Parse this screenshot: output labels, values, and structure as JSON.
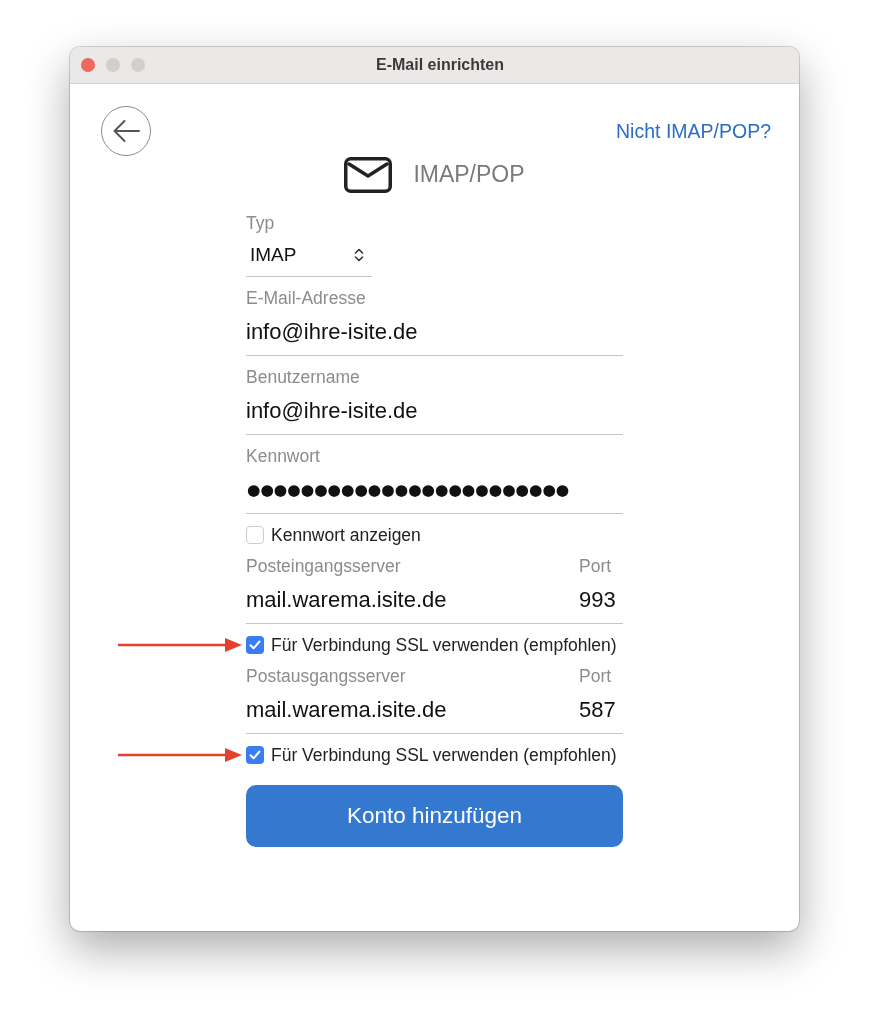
{
  "window": {
    "title": "E-Mail einrichten"
  },
  "header": {
    "link": "Nicht IMAP/POP?"
  },
  "account_type": {
    "name": "IMAP/POP"
  },
  "form": {
    "rows": [
      {
        "kind": "select",
        "label": "Typ",
        "value": "IMAP"
      },
      {
        "kind": "text",
        "label": "E-Mail-Adresse",
        "value": "info@ihre-isite.de"
      },
      {
        "kind": "text",
        "label": "Benutzername",
        "value": "info@ihre-isite.de"
      },
      {
        "kind": "password",
        "label": "Kennwort",
        "value": "●●●●●●●●●●●●●●●●●●●●●●●●"
      },
      {
        "kind": "checkbox",
        "label": "Kennwort anzeigen",
        "checked": false,
        "highlighted": false
      },
      {
        "kind": "server",
        "label": "Posteingangsserver",
        "value": "mail.warema.isite.de",
        "port_label": "Port",
        "port": "993"
      },
      {
        "kind": "checkbox",
        "label": "Für Verbindung SSL verwenden (empfohlen)",
        "checked": true,
        "highlighted": true
      },
      {
        "kind": "server",
        "label": "Postausgangsserver",
        "value": "mail.warema.isite.de",
        "port_label": "Port",
        "port": "587"
      },
      {
        "kind": "checkbox",
        "label": "Für Verbindung SSL verwenden (empfohlen)",
        "checked": true,
        "highlighted": true
      }
    ]
  },
  "submit_button": {
    "label": "Konto hinzufügen"
  }
}
